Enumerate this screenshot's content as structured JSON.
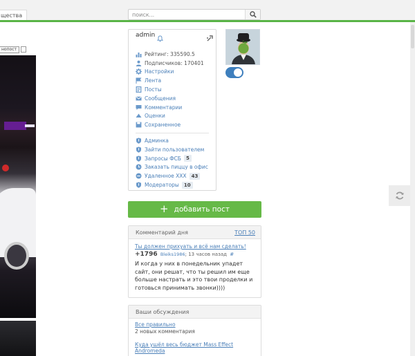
{
  "header": {
    "left_tab": "щества",
    "search": {
      "placeholder": "поиск..."
    }
  },
  "post": {
    "tag": "нопост"
  },
  "user": {
    "name": "admin",
    "menu": [
      {
        "icon": "bar-chart-icon",
        "label": "Рейтинг: 335590.5",
        "link": false
      },
      {
        "icon": "person-icon",
        "label": "Подписчиков: 170401",
        "link": false
      },
      {
        "icon": "gear-icon",
        "label": "Настройки",
        "link": true
      },
      {
        "icon": "flag-icon",
        "label": "Лента",
        "link": true
      },
      {
        "icon": "document-icon",
        "label": "Посты",
        "link": true
      },
      {
        "icon": "envelope-icon",
        "label": "Сообщения",
        "link": true
      },
      {
        "icon": "speech-bubble-icon",
        "label": "Комментарии",
        "link": true
      },
      {
        "icon": "triangle-up-icon",
        "label": "Оценки",
        "link": true
      },
      {
        "icon": "save-icon",
        "label": "Сохраненное",
        "link": true
      }
    ],
    "admin_menu": [
      {
        "icon": "shield-icon",
        "label": "Админка",
        "badge": ""
      },
      {
        "icon": "shield-icon",
        "label": "Зайти пользователем",
        "badge": ""
      },
      {
        "icon": "shield-icon",
        "label": "Запросы ФСБ",
        "badge": "5"
      },
      {
        "icon": "clock-icon",
        "label": "Заказать пиццу в офис",
        "badge": ""
      },
      {
        "icon": "minus-circle-icon",
        "label": "Удаленное XXX",
        "badge": "43"
      },
      {
        "icon": "shield-icon",
        "label": "Модераторы",
        "badge": "10"
      }
    ]
  },
  "add_post": {
    "label": "добавить пост"
  },
  "comment_of_day": {
    "heading": "Комментарий дня",
    "top_link": "ТОП 50",
    "title": "Ты должен прихуать и всё нам сделать!",
    "score": "+1796",
    "author": "Bleiks1986",
    "time": "13 часов назад",
    "hash": "#",
    "text": "И когда у них в понедельник упадет сайт, они решат, что ты решил им еще больше настрать и это твои проделки и готовься принимать звонки))))"
  },
  "discussions": {
    "heading": "Ваши обсуждения",
    "items": [
      {
        "title": "Все правильно",
        "subtitle": "2 новых комментария"
      },
      {
        "title": "Куда ушёл весь бюджет Mass Effect Andromeda",
        "subtitle": ""
      }
    ]
  },
  "colors": {
    "accent_green": "#59b446",
    "link_blue": "#4a7fb8",
    "button_green": "#66b947"
  }
}
